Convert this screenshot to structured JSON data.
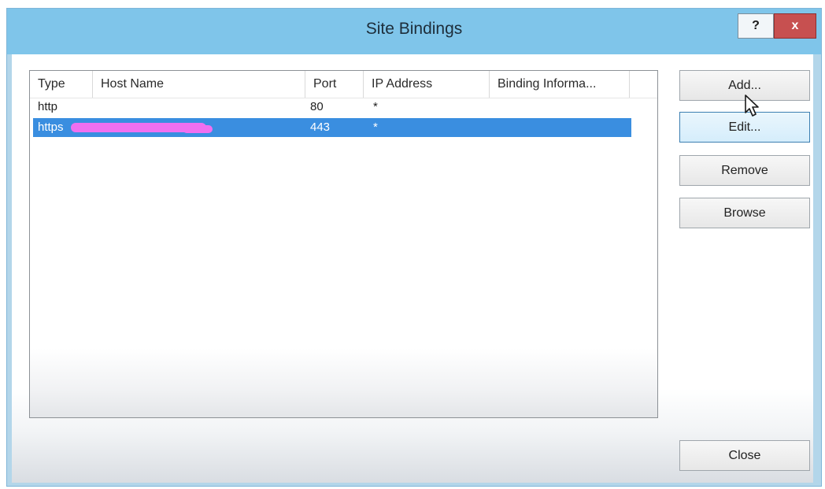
{
  "window": {
    "title": "Site Bindings",
    "help_label": "?",
    "close_label": "x"
  },
  "list": {
    "columns": [
      "Type",
      "Host Name",
      "Port",
      "IP Address",
      "Binding Informa..."
    ],
    "rows": [
      {
        "type": "http",
        "host": "",
        "port": "80",
        "ip": "*",
        "binding": "",
        "selected": false
      },
      {
        "type": "https",
        "host": "",
        "port": "443",
        "ip": "*",
        "binding": "",
        "selected": true
      }
    ]
  },
  "buttons": {
    "add": "Add...",
    "edit": "Edit...",
    "remove": "Remove",
    "browse": "Browse",
    "close": "Close"
  },
  "colors": {
    "titlebar": "#7fc5ea",
    "selection": "#3a8ee0",
    "close_button": "#c75050",
    "redaction": "#f06ff0"
  },
  "icons": {
    "cursor": "arrow-cursor-icon"
  }
}
